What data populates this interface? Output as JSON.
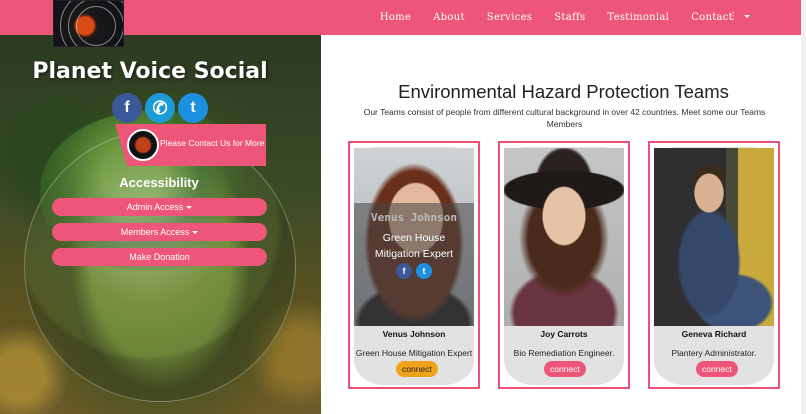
{
  "brand": {
    "title": "Planet Voice Social",
    "logo_icon": "solar-system-logo"
  },
  "nav": {
    "links": [
      "Home",
      "About",
      "Services",
      "Staffs",
      "Testimonial",
      "Contact"
    ],
    "more_label": "⋮"
  },
  "sidebar": {
    "social": [
      {
        "icon": "facebook-icon",
        "glyph": "f",
        "color": "#3b5998"
      },
      {
        "icon": "phone-icon",
        "glyph": "✆",
        "color": "#1d9bd6"
      },
      {
        "icon": "tumblr-icon",
        "glyph": "t",
        "color": "#1d8fe0"
      }
    ],
    "contact_banner": "Please Contact Us for More",
    "accessibility_title": "Accessibility",
    "buttons": [
      "Admin Access",
      "Members Access",
      "Make Donation"
    ]
  },
  "team": {
    "title": "Environmental Hazard Protection Teams",
    "description": "Our Teams consist of people from different cultural background in over 42 countries. Meet some our Teams Members",
    "members": [
      {
        "name": "Venus Johnson",
        "role": "Green House Mitigation Expert",
        "connect": "connect"
      },
      {
        "name": "Joy Carrots",
        "role": "Bio Remediation Engineer.",
        "connect": "connect"
      },
      {
        "name": "Geneva Richard",
        "role": "Plantery Administrator.",
        "connect": "connect"
      }
    ],
    "overlay": {
      "name": "Venus Johnson",
      "role": "Green House Mitigation Expert",
      "social": [
        "f",
        "t"
      ]
    }
  },
  "colors": {
    "accent": "#ee5679",
    "gold": "#f0a31a",
    "facebook": "#3b5998"
  }
}
